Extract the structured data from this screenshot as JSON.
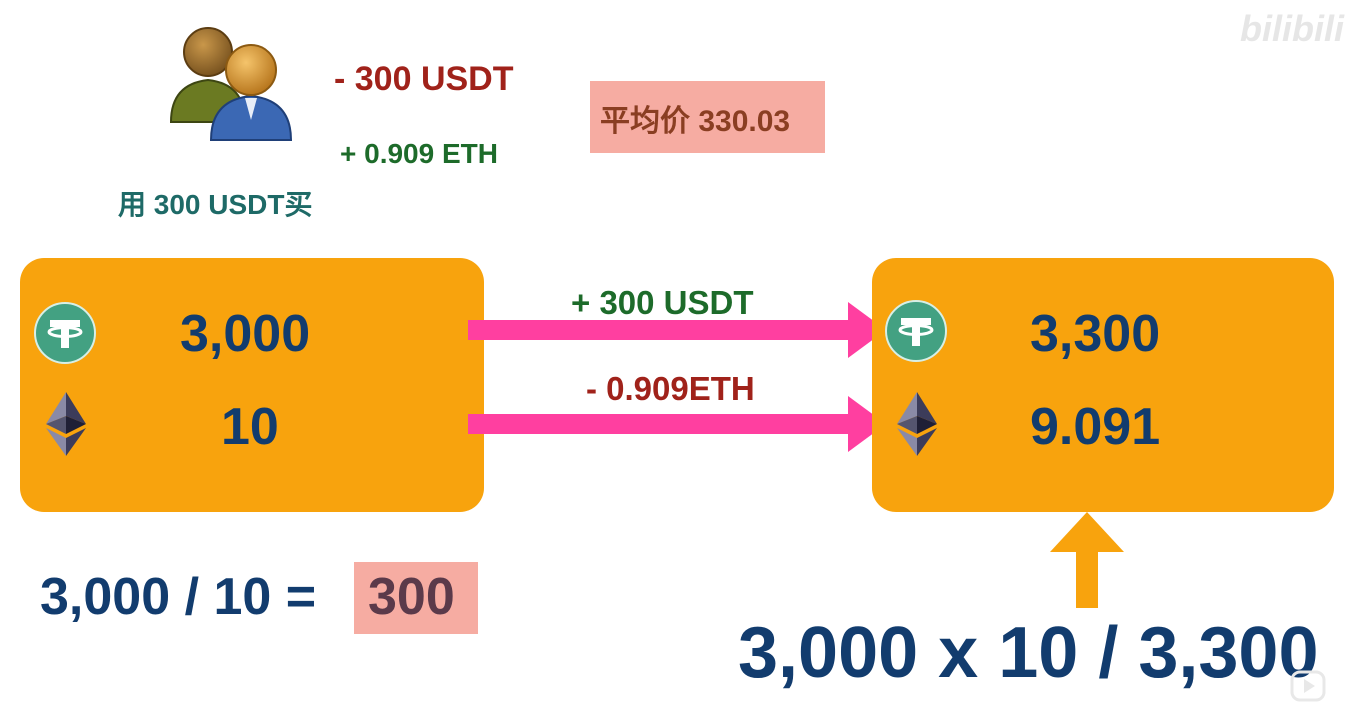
{
  "trader": {
    "deduct": "- 300 USDT",
    "receive": "+ 0.909 ETH",
    "action": "用 300 USDT买"
  },
  "average_price": "平均价 330.03",
  "pool_before": {
    "usdt": "3,000",
    "eth": "10"
  },
  "transfer": {
    "usdt_in": "+ 300 USDT",
    "eth_out": "- 0.909ETH"
  },
  "pool_after": {
    "usdt": "3,300",
    "eth": "9.091"
  },
  "price_formula": {
    "expression": "3,000 / 10 =",
    "result": "300"
  },
  "k_formula": "3,000 x 10 / 3,300",
  "watermark": "bilibili",
  "icons": [
    "users-icon",
    "tether-icon",
    "ethereum-icon",
    "play-icon"
  ],
  "colors": {
    "pool": "#f8a30d",
    "arrow": "#ff3fa0",
    "highlight": "#f6aca2",
    "numbers": "#123c6e",
    "negative": "#a0221a",
    "positive": "#1d6b2a"
  }
}
